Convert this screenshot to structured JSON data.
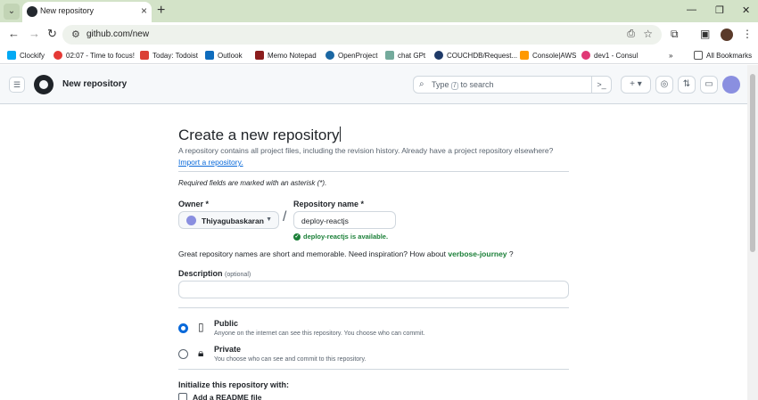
{
  "browser": {
    "tab_title": "New repository",
    "url": "github.com/new",
    "bookmarks": [
      {
        "label": "Clockify",
        "color": "#03a9f4"
      },
      {
        "label": "02:07 - Time to focus!",
        "color": "#e53935"
      },
      {
        "label": "Today: Todoist",
        "color": "#db4035"
      },
      {
        "label": "Outlook",
        "color": "#0f6cbd"
      },
      {
        "label": "Memo Notepad",
        "color": "#8b1d1d"
      },
      {
        "label": "OpenProject",
        "color": "#1a67a3"
      },
      {
        "label": "chat GPt",
        "color": "#74aa9c"
      },
      {
        "label": "COUCHDB/Request...",
        "color": "#1f3a68"
      },
      {
        "label": "Console|AWS",
        "color": "#ff9900"
      },
      {
        "label": "dev1 - Consul",
        "color": "#e03875"
      }
    ],
    "all_bookmarks": "All Bookmarks"
  },
  "github": {
    "page_title": "New repository",
    "search_prefix": "Type",
    "search_key": "/",
    "search_suffix": "to search"
  },
  "form": {
    "heading": "Create a new repository",
    "lead": "A repository contains all project files, including the revision history. Already have a project repository elsewhere?",
    "import_link": "Import a repository.",
    "required_note": "Required fields are marked with an asterisk (*).",
    "owner_label": "Owner *",
    "owner_value": "Thiyagubaskaran",
    "repo_label": "Repository name *",
    "repo_value": "deploy-reactjs",
    "availability": "deploy-reactjs is available.",
    "inspire_text": "Great repository names are short and memorable. Need inspiration? How about",
    "suggestion": "verbose-journey",
    "inspire_end": "?",
    "description_label": "Description",
    "description_optional": "(optional)",
    "description_value": "",
    "public_title": "Public",
    "public_desc": "Anyone on the internet can see this repository. You choose who can commit.",
    "private_title": "Private",
    "private_desc": "You choose who can see and commit to this repository.",
    "init_label": "Initialize this repository with:",
    "readme_label": "Add a README file",
    "visibility_selected": "public"
  }
}
